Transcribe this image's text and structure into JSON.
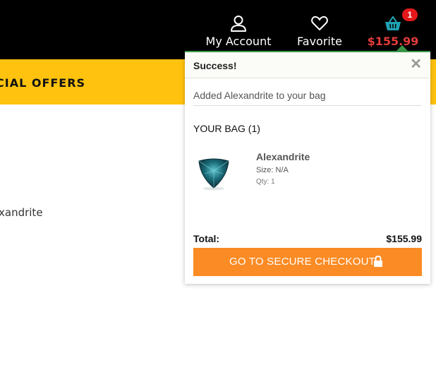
{
  "header": {
    "nav": {
      "account": {
        "label": "My Account",
        "icon": "user-icon"
      },
      "favorite": {
        "label": "Favorite",
        "icon": "heart-icon"
      },
      "cart": {
        "label": "$155.99",
        "icon": "basket-icon",
        "badge": "1"
      }
    }
  },
  "offers_bar": {
    "text": "CIAL OFFERS"
  },
  "page": {
    "product_fragment": "xandrite"
  },
  "minicart": {
    "title": "Success!",
    "close_icon": "close-icon",
    "message": "Added Alexandrite to your bag",
    "bag_title": "YOUR BAG (1)",
    "item": {
      "name": "Alexandrite",
      "size": "Size: N/A",
      "qty": "Qty: 1",
      "image": "gemstone-image"
    },
    "total_label": "Total:",
    "total_value": "$155.99",
    "checkout_label": "GO TO SECURE CHECKOUT",
    "checkout_icon": "lock-icon"
  },
  "colors": {
    "header_bg": "#000000",
    "offers_bg": "#ffc20e",
    "cart_price": "#e23b3b",
    "badge": "#e3181b",
    "checkout_button": "#fb8b24",
    "popup_accent": "#3c9a4a",
    "basket_icon": "#1fa3b4"
  }
}
